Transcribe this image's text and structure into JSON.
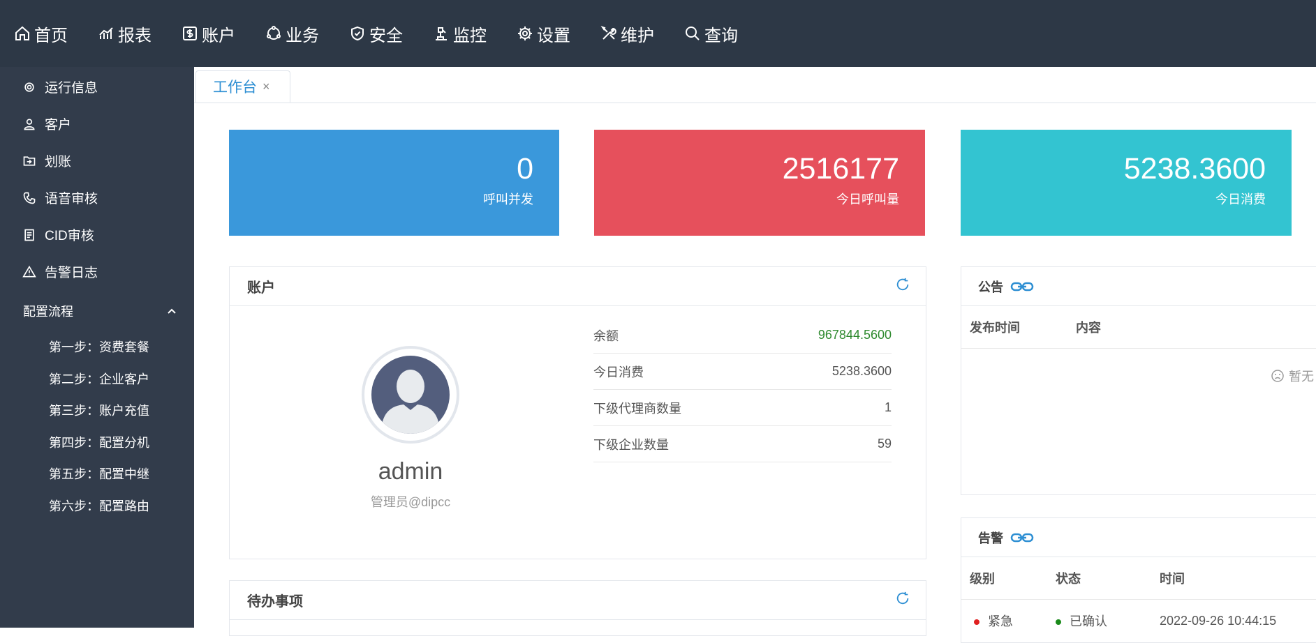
{
  "topnav": {
    "items": [
      {
        "label": "首页",
        "icon": "home-icon"
      },
      {
        "label": "报表",
        "icon": "chart-icon"
      },
      {
        "label": "账户",
        "icon": "dollar-icon"
      },
      {
        "label": "业务",
        "icon": "cycle-icon"
      },
      {
        "label": "安全",
        "icon": "shield-icon"
      },
      {
        "label": "监控",
        "icon": "monitor-icon"
      },
      {
        "label": "设置",
        "icon": "gear-icon"
      },
      {
        "label": "维护",
        "icon": "tools-icon"
      },
      {
        "label": "查询",
        "icon": "search-icon"
      }
    ]
  },
  "sidebar": {
    "items": [
      {
        "label": "运行信息",
        "icon": "gear-icon"
      },
      {
        "label": "客户",
        "icon": "user-icon"
      },
      {
        "label": "划账",
        "icon": "transfer-icon"
      },
      {
        "label": "语音审核",
        "icon": "phone-icon"
      },
      {
        "label": "CID审核",
        "icon": "document-icon"
      },
      {
        "label": "告警日志",
        "icon": "warning-icon"
      }
    ],
    "group": {
      "label": "配置流程",
      "expanded": true,
      "subitems": [
        "第一步：资费套餐",
        "第二步：企业客户",
        "第三步：账户充值",
        "第四步：配置分机",
        "第五步：配置中继",
        "第六步：配置路由"
      ]
    }
  },
  "tabs": [
    {
      "label": "工作台",
      "close": "×"
    }
  ],
  "stats": [
    {
      "value": "0",
      "label": "呼叫并发",
      "color": "#3a98db"
    },
    {
      "value": "2516177",
      "label": "今日呼叫量",
      "color": "#e6505c"
    },
    {
      "value": "5238.3600",
      "label": "今日消费",
      "color": "#33c4d1"
    }
  ],
  "account": {
    "title": "账户",
    "username": "admin",
    "role": "管理员@dipcc",
    "rows": [
      {
        "label": "余额",
        "value": "967844.5600"
      },
      {
        "label": "今日消费",
        "value": "5238.3600"
      },
      {
        "label": "下级代理商数量",
        "value": "1"
      },
      {
        "label": "下级企业数量",
        "value": "59"
      }
    ]
  },
  "todo": {
    "title": "待办事项"
  },
  "notice": {
    "title": "公告",
    "columns": [
      "发布时间",
      "内容"
    ],
    "empty": "暂无"
  },
  "alarm": {
    "title": "告警",
    "columns": [
      "级别",
      "状态",
      "时间"
    ],
    "rows": [
      {
        "level": "紧急",
        "status": "已确认",
        "time": "2022-09-26 10:44:15",
        "level_color": "#e02020",
        "status_color": "#1a8a1a"
      }
    ]
  }
}
